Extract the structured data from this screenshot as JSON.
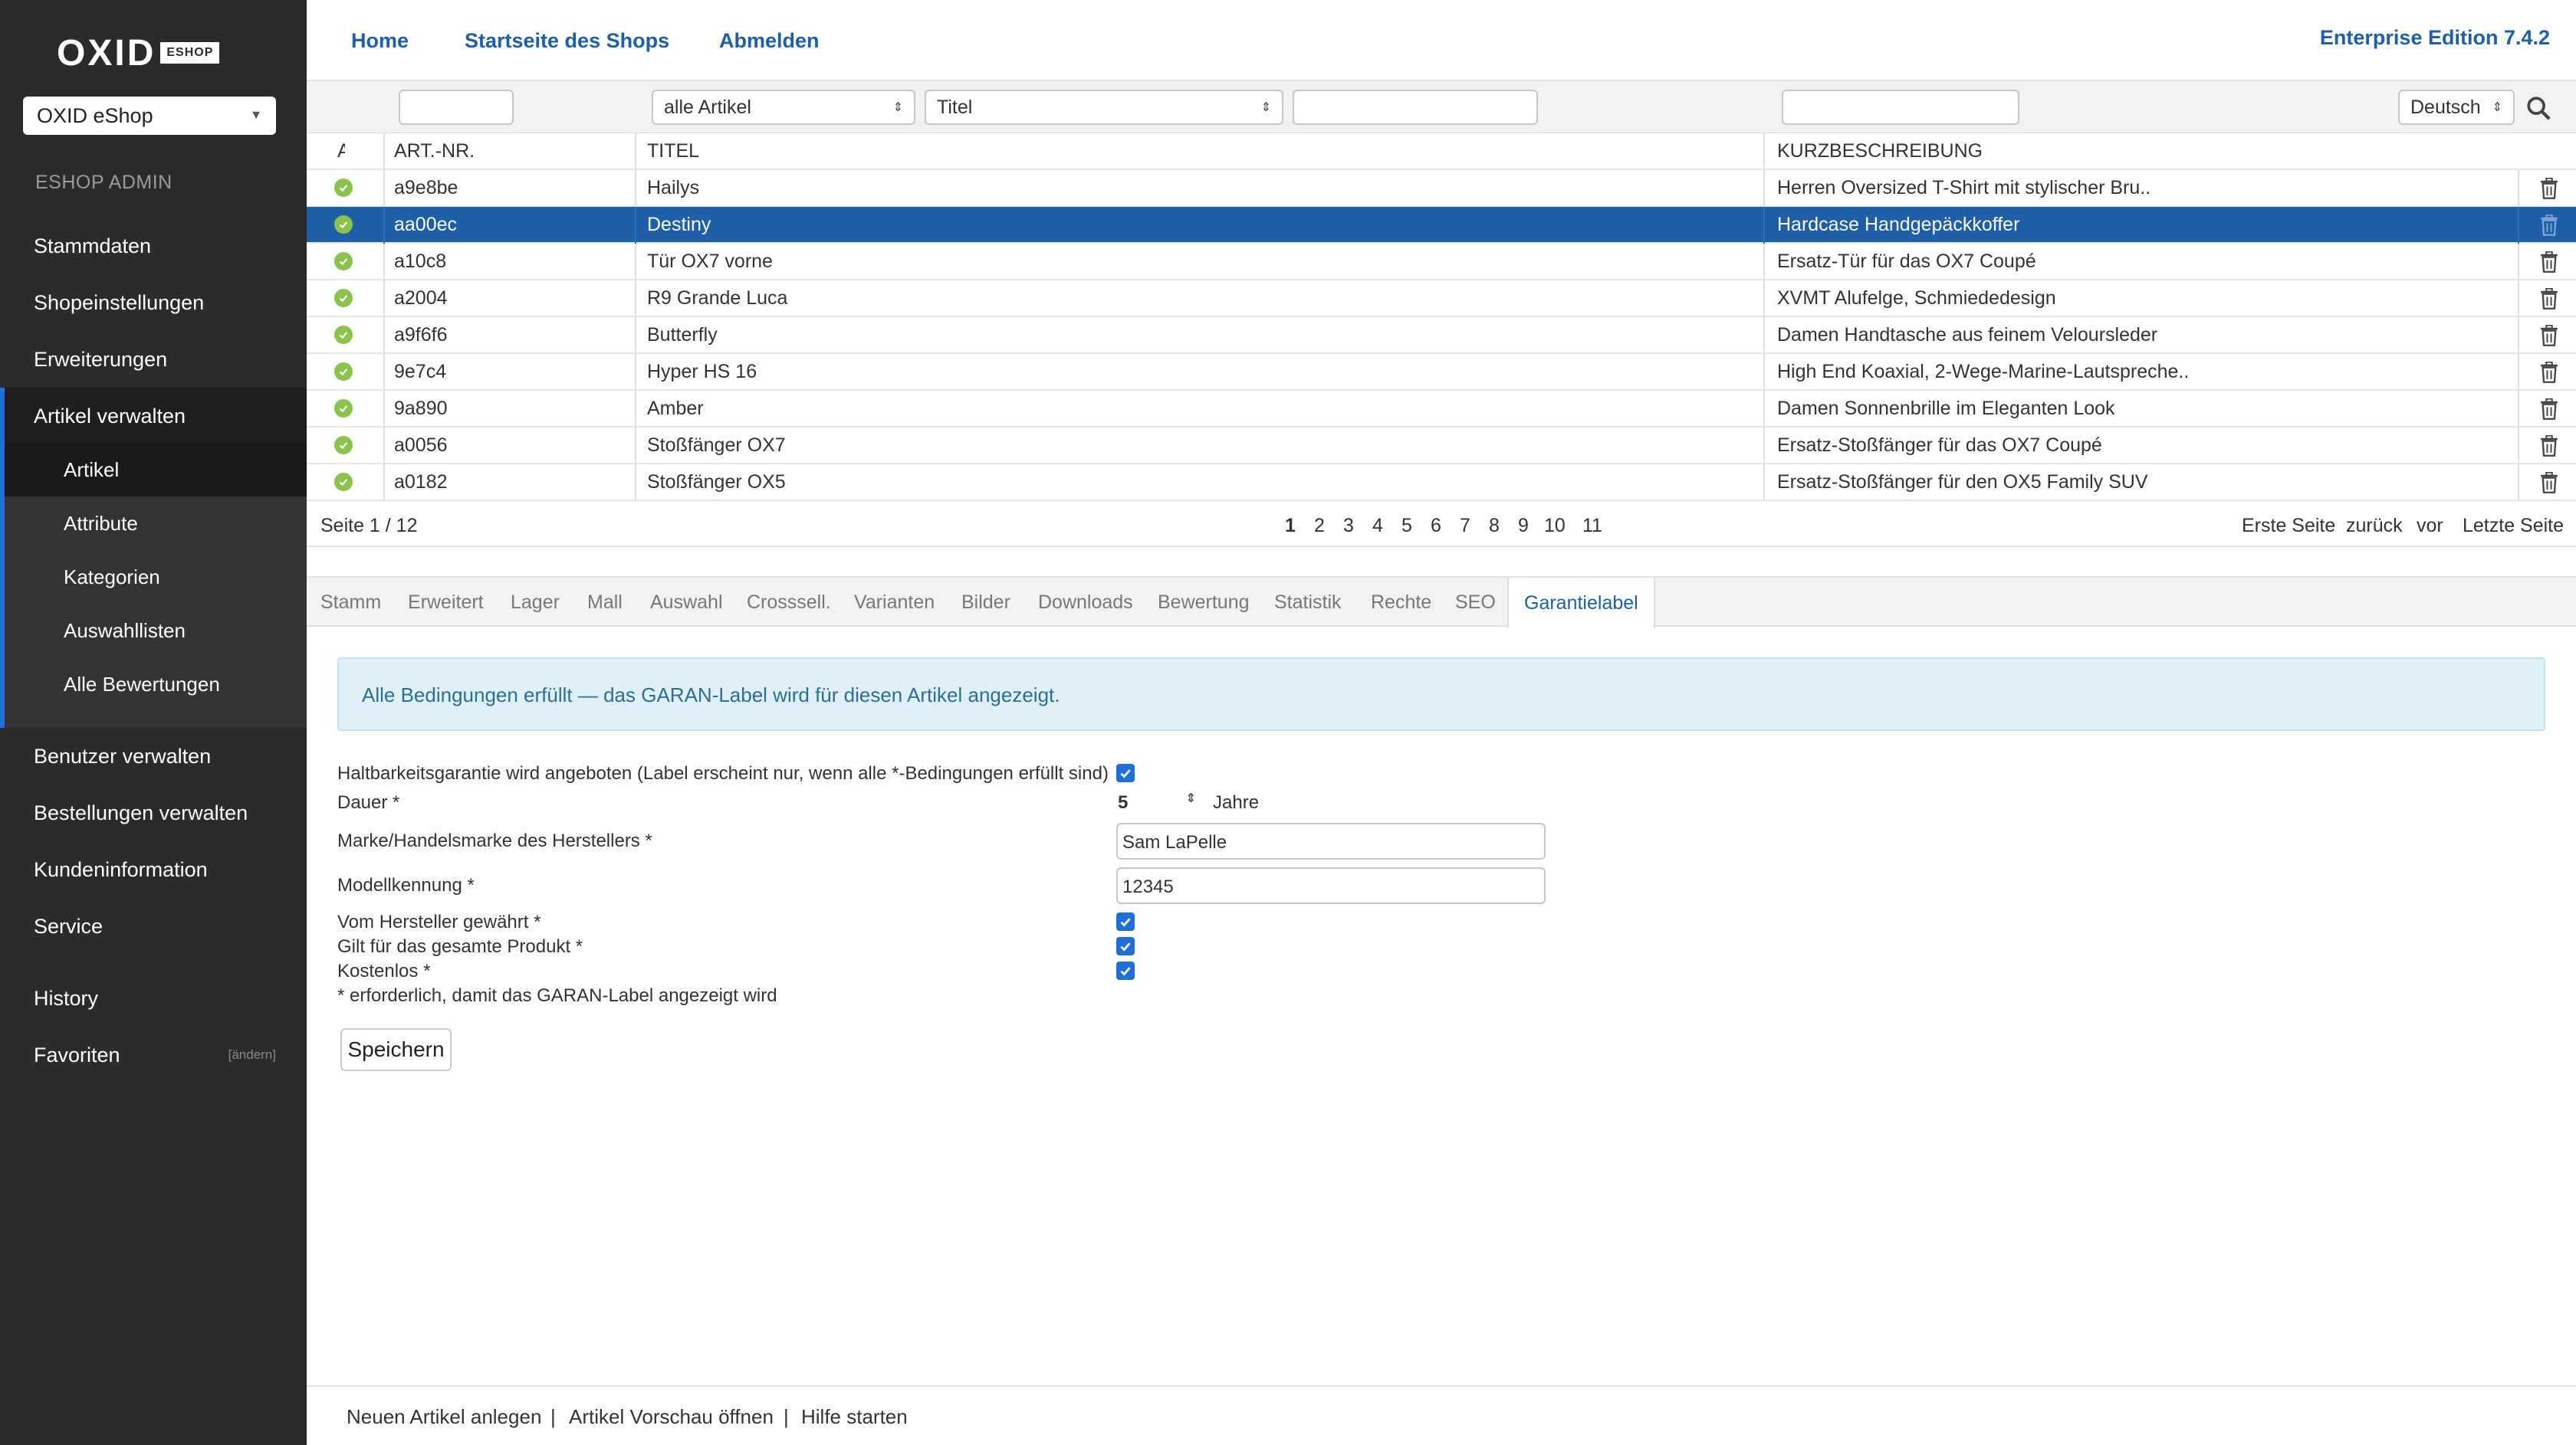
{
  "sidebar": {
    "logo_text": "OXID",
    "logo_badge": "ESHOP",
    "shop_select": "OXID eShop",
    "admin_label": "ESHOP ADMIN",
    "nav": [
      {
        "label": "Stammdaten"
      },
      {
        "label": "Shopeinstellungen"
      },
      {
        "label": "Erweiterungen"
      },
      {
        "label": "Artikel verwalten"
      }
    ],
    "subnav": [
      {
        "label": "Artikel"
      },
      {
        "label": "Attribute"
      },
      {
        "label": "Kategorien"
      },
      {
        "label": "Auswahllisten"
      },
      {
        "label": "Alle Bewertungen"
      }
    ],
    "nav2": [
      {
        "label": "Benutzer verwalten"
      },
      {
        "label": "Bestellungen verwalten"
      },
      {
        "label": "Kundeninformation"
      },
      {
        "label": "Service"
      }
    ],
    "history": "History",
    "favorites": "Favoriten",
    "favorites_edit": "[ändern]"
  },
  "topbar": {
    "home": "Home",
    "shop_start": "Startseite des Shops",
    "logout": "Abmelden",
    "edition": "Enterprise Edition 7.4.2"
  },
  "filters": {
    "type_select": "alle Artikel",
    "field_select": "Titel",
    "language_select": "Deutsch"
  },
  "table": {
    "headers": {
      "active": "A",
      "artnum": "ART.-NR.",
      "title": "TITEL",
      "short_desc": "KURZBESCHREIBUNG"
    },
    "rows": [
      {
        "artnum": "a9e8be",
        "title": "Hailys",
        "desc": "Herren Oversized T-Shirt mit stylischer Bru.."
      },
      {
        "artnum": "aa00ec",
        "title": "Destiny",
        "desc": "Hardcase Handgepäckkoffer"
      },
      {
        "artnum": "a10c8",
        "title": "Tür OX7 vorne",
        "desc": "Ersatz-Tür für das OX7 Coupé"
      },
      {
        "artnum": "a2004",
        "title": "R9 Grande Luca",
        "desc": "XVMT Alufelge, Schmiededesign"
      },
      {
        "artnum": "a9f6f6",
        "title": "Butterfly",
        "desc": "Damen Handtasche aus feinem Veloursleder"
      },
      {
        "artnum": "9e7c4",
        "title": "Hyper HS 16",
        "desc": "High End Koaxial, 2-Wege-Marine-Lautspreche.."
      },
      {
        "artnum": "9a890",
        "title": "Amber",
        "desc": "Damen Sonnenbrille im Eleganten Look"
      },
      {
        "artnum": "a0056",
        "title": "Stoßfänger OX7",
        "desc": "Ersatz-Stoßfänger für das OX7 Coupé"
      },
      {
        "artnum": "a0182",
        "title": "Stoßfänger OX5",
        "desc": "Ersatz-Stoßfänger für den OX5 Family SUV"
      }
    ]
  },
  "pager": {
    "info": "Seite 1 / 12",
    "pages": [
      "1",
      "2",
      "3",
      "4",
      "5",
      "6",
      "7",
      "8",
      "9",
      "10",
      "11"
    ],
    "first": "Erste Seite",
    "back": "zurück",
    "forward": "vor",
    "last": "Letzte Seite"
  },
  "tabs": [
    "Stamm",
    "Erweitert",
    "Lager",
    "Mall",
    "Auswahl",
    "Crosssell.",
    "Varianten",
    "Bilder",
    "Downloads",
    "Bewertung",
    "Statistik",
    "Rechte",
    "SEO",
    "Garantielabel"
  ],
  "content": {
    "info": "Alle Bedingungen erfüllt — das GARAN-Label wird für diesen Artikel angezeigt.",
    "guarantee_label": "Haltbarkeitsgarantie wird angeboten (Label erscheint nur, wenn alle *-Bedingungen erfüllt sind)",
    "duration_label": "Dauer *",
    "duration_value": "5",
    "duration_unit": "Jahre",
    "brand_label": "Marke/Handelsmarke des Herstellers *",
    "brand_value": "Sam LaPelle",
    "model_label": "Modellkennung *",
    "model_value": "12345",
    "manufacturer_label": "Vom Hersteller gewährt *",
    "whole_product_label": "Gilt für das gesamte Produkt *",
    "free_label": "Kostenlos *",
    "required_note": "* erforderlich, damit das GARAN-Label angezeigt wird",
    "save": "Speichern"
  },
  "footer": {
    "new_article": "Neuen Artikel anlegen",
    "preview": "Artikel Vorschau öffnen",
    "help": "Hilfe starten",
    "separator": "|"
  },
  "colors": {
    "accent": "#1e5fa8",
    "sidebar": "#2b2b2b",
    "active_bar": "#1e6fd9",
    "status": "#8cc34a"
  }
}
